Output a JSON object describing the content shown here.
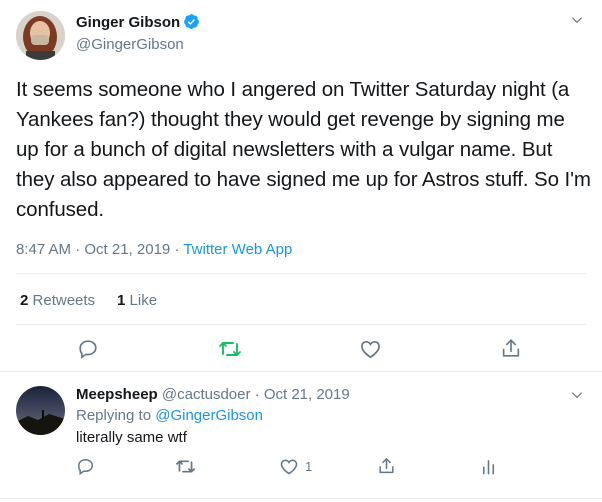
{
  "main_tweet": {
    "author_name": "Ginger Gibson",
    "author_handle": "@GingerGibson",
    "text": "It seems someone who I angered on Twitter Saturday night (a Yankees fan?) thought they would get revenge by signing me up for a bunch of digital newsletters with a vulgar name. But they also appeared to have signed me up for Astros stuff. So I'm confused.",
    "timestamp": "8:47 AM · Oct 21, 2019",
    "separator": "·",
    "source": "Twitter Web App",
    "retweets_count": "2",
    "retweets_label": "Retweets",
    "likes_count": "1",
    "likes_label": "Like"
  },
  "reply": {
    "author_name": "Meepsheep",
    "author_handle": "@cactusdoer",
    "date": "· Oct 21, 2019",
    "replying_prefix": "Replying to",
    "replying_handle": "@GingerGibson",
    "text": "literally same wtf",
    "like_count": "1"
  },
  "colors": {
    "accent": "#1b95e0",
    "retweet_green": "#17bf63",
    "muted": "#657786",
    "text": "#14171a"
  },
  "icons": [
    "verified-badge-icon",
    "chevron-down-icon",
    "reply-icon",
    "retweet-icon",
    "like-icon",
    "share-icon",
    "analytics-icon"
  ]
}
